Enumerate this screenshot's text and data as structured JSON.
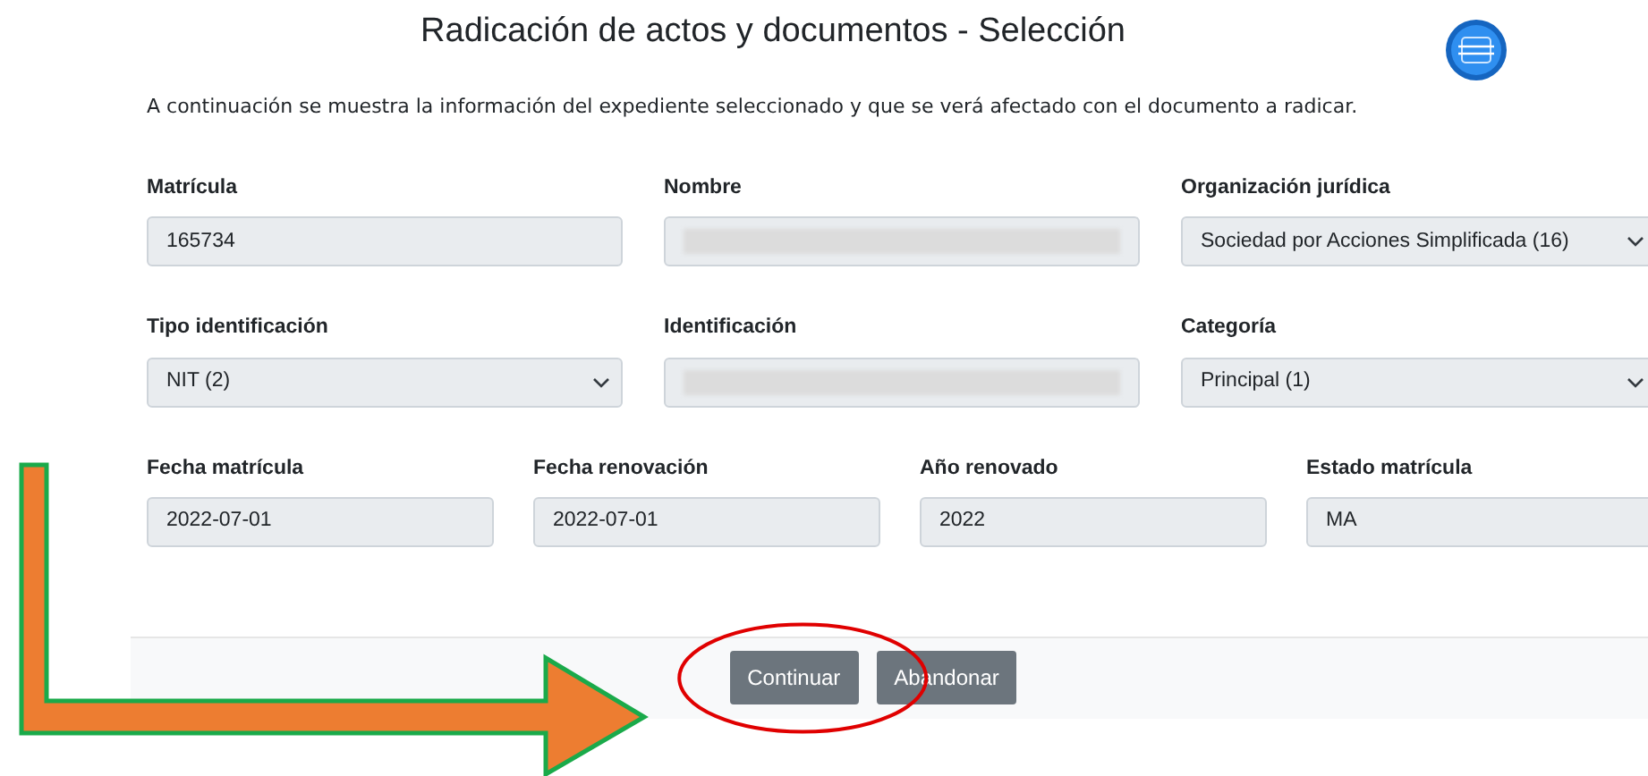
{
  "title": "Radicación de actos y documentos - Selección",
  "intro": "A continuación se muestra la información del expediente seleccionado y que se verá afectado con el documento a radicar.",
  "rows": [
    [
      {
        "label": "Matrícula",
        "kind": "input",
        "value": "165734"
      },
      {
        "label": "Nombre",
        "kind": "masked"
      },
      {
        "label": "Organización jurídica",
        "kind": "select",
        "value": "Sociedad por Acciones Simplificada (16)"
      }
    ],
    [
      {
        "label": "Tipo identificación",
        "kind": "select",
        "value": "NIT (2)"
      },
      {
        "label": "Identificación",
        "kind": "masked"
      },
      {
        "label": "Categoría",
        "kind": "select",
        "value": "Principal (1)"
      }
    ],
    [
      {
        "label": "Fecha matrícula",
        "kind": "input",
        "value": "2022-07-01"
      },
      {
        "label": "Fecha renovación",
        "kind": "input",
        "value": "2022-07-01"
      },
      {
        "label": "Año renovado",
        "kind": "input",
        "value": "2022"
      },
      {
        "label": "Estado matrícula",
        "kind": "input",
        "value": "MA"
      }
    ]
  ],
  "buttons": [
    {
      "label": "Continuar",
      "highlighted": true
    },
    {
      "label": "Abandonar",
      "highlighted": false
    }
  ]
}
